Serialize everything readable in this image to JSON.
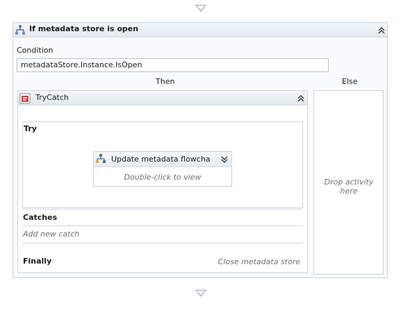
{
  "if_activity": {
    "title": "If metadata store is open",
    "condition_label": "Condition",
    "condition_value": "metadataStore.Instance.IsOpen",
    "then_label": "Then",
    "else_label": "Else",
    "else_drop_hint": "Drop activity here"
  },
  "trycatch": {
    "title": "TryCatch",
    "try_label": "Try",
    "catches_label": "Catches",
    "add_catch_hint": "Add new catch",
    "finally_label": "Finally",
    "finally_hint": "Close metadata store"
  },
  "flowchart_activity": {
    "title": "Update metadata flowchart",
    "hint": "Double-click to view"
  },
  "icons": {
    "if_icon": "if-activity-icon",
    "trycatch_icon": "trycatch-icon",
    "flowchart_icon": "flowchart-icon",
    "collapse": "chevron-up-double-icon",
    "expand": "chevron-down-double-icon"
  }
}
